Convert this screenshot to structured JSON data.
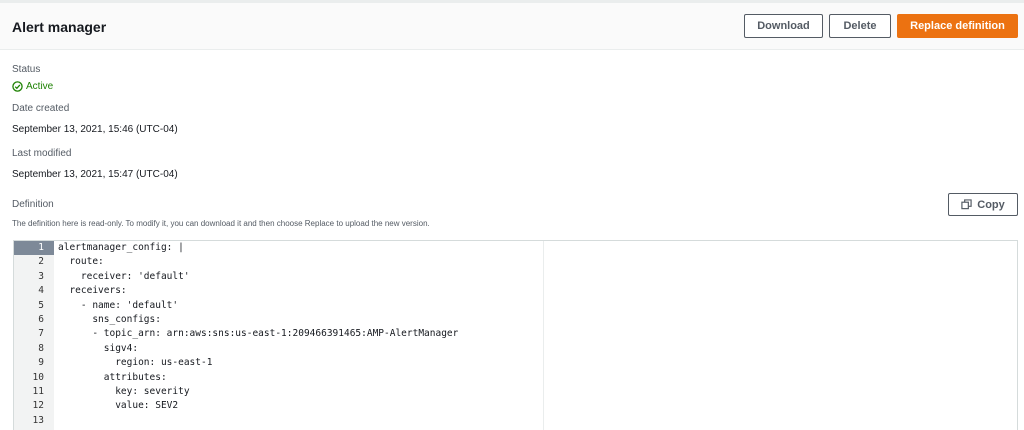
{
  "header": {
    "title": "Alert manager",
    "download_label": "Download",
    "delete_label": "Delete",
    "replace_label": "Replace definition"
  },
  "details": {
    "status_label": "Status",
    "status_value": "Active",
    "date_created_label": "Date created",
    "date_created_value": "September 13, 2021, 15:46 (UTC-04)",
    "last_modified_label": "Last modified",
    "last_modified_value": "September 13, 2021, 15:47 (UTC-04)"
  },
  "definition": {
    "label": "Definition",
    "description": "The definition here is read-only. To modify it, you can download it and then choose Replace to upload the new version.",
    "copy_label": "Copy",
    "lines": [
      "alertmanager_config: |",
      "  route:",
      "    receiver: 'default'",
      "  receivers:",
      "    - name: 'default'",
      "      sns_configs:",
      "      - topic_arn: arn:aws:sns:us-east-1:209466391465:AMP-AlertManager",
      "        sigv4:",
      "          region: us-east-1",
      "        attributes:",
      "          key: severity",
      "          value: SEV2",
      ""
    ]
  },
  "colors": {
    "accent": "#ec7211",
    "success": "#1d8102"
  }
}
